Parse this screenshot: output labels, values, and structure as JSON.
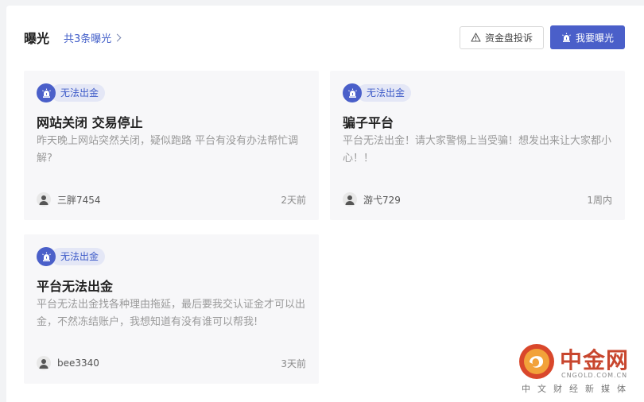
{
  "header": {
    "title": "曝光",
    "count_link": "共3条曝光",
    "complain_button": "资金盘投诉",
    "expose_button": "我要曝光"
  },
  "cards": [
    {
      "badge": "无法出金",
      "title": "网站关闭 交易停止",
      "desc": "昨天晚上网站突然关闭，疑似跑路 平台有没有办法帮忙调解?",
      "user": "三胖7454",
      "time": "2天前"
    },
    {
      "badge": "无法出金",
      "title": "骗子平台",
      "desc": "平台无法出金！请大家警惕上当受骗！想发出来让大家都小心！！",
      "user": "游弋729",
      "time": "1周内"
    },
    {
      "badge": "无法出金",
      "title": "平台无法出金",
      "desc": "平台无法出金找各种理由拖延，最后要我交认证金才可以出金，不然冻结账户，我想知道有没有谁可以帮我!",
      "user": "bee3340",
      "time": "3天前"
    }
  ],
  "watermark": {
    "name": "中金网",
    "domain": "CNGOLD.COM.CN",
    "slogan": "中文财经新媒体"
  },
  "colors": {
    "accent": "#4a5fc9",
    "link": "#3f5cc8",
    "card_bg": "#f7f7f9",
    "watermark_red": "#c8462e"
  }
}
